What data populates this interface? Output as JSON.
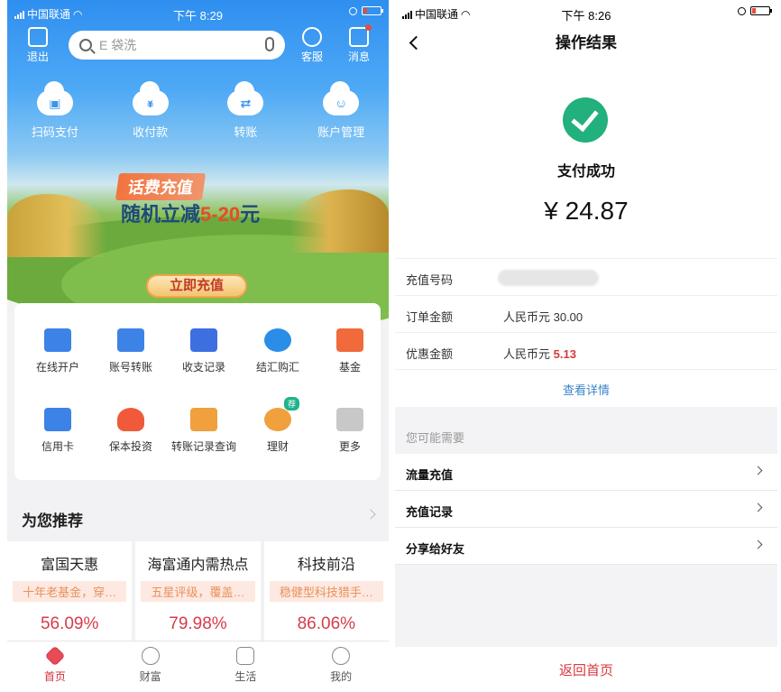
{
  "left": {
    "status_bar": {
      "carrier": "中国联通",
      "time": "下午 8:29"
    },
    "topbar": {
      "logout": "退出",
      "search_placeholder": "E 袋洗",
      "service": "客服",
      "messages": "消息"
    },
    "quick_actions": [
      "扫码支付",
      "收付款",
      "转账",
      "账户管理"
    ],
    "quick_icons": [
      "qr-scan-icon",
      "yen-icon",
      "transfer-icon",
      "user-icon"
    ],
    "banner": {
      "tag": "话费充值",
      "line_prefix": "随机立减",
      "line_amount": "5-20",
      "line_suffix": "元",
      "button": "立即充值"
    },
    "grid": [
      {
        "label": "在线开户",
        "icon": "card-e-icon",
        "color": "#3d82e6"
      },
      {
        "label": "账号转账",
        "icon": "card-transfer-icon",
        "color": "#3d82e6"
      },
      {
        "label": "收支记录",
        "icon": "ledger-icon",
        "color": "#3d6fe0"
      },
      {
        "label": "结汇购汇",
        "icon": "currency-exchange-icon",
        "color": "#2a8ee8"
      },
      {
        "label": "基金",
        "icon": "fund-chart-icon",
        "color": "#f06a3c"
      },
      {
        "label": "信用卡",
        "icon": "credit-card-icon",
        "color": "#3d82e6"
      },
      {
        "label": "保本投资",
        "icon": "shield-icon",
        "color": "#f05a3a"
      },
      {
        "label": "转账记录查询",
        "icon": "record-search-icon",
        "color": "#f0a03c"
      },
      {
        "label": "理财",
        "icon": "money-bag-icon",
        "color": "#f0a03c",
        "badge": "荐"
      },
      {
        "label": "更多",
        "icon": "more-grid-icon",
        "color": "#c8c8c8"
      }
    ],
    "recommend_title": "为您推荐",
    "products": [
      {
        "title": "富国天惠",
        "sub": "十年老基金，穿…",
        "value": "56.09%"
      },
      {
        "title": "海富通内需热点",
        "sub": "五星评级，覆盖…",
        "value": "79.98%"
      },
      {
        "title": "科技前沿",
        "sub": "稳健型科技猎手…",
        "value": "86.06%"
      }
    ],
    "tabs": [
      {
        "label": "首页",
        "icon": "diamond-icon"
      },
      {
        "label": "财富",
        "icon": "wealth-icon"
      },
      {
        "label": "生活",
        "icon": "life-bag-icon"
      },
      {
        "label": "我的",
        "icon": "profile-icon"
      }
    ]
  },
  "right": {
    "status_bar": {
      "carrier": "中国联通",
      "time": "下午 8:26"
    },
    "title": "操作结果",
    "status_text": "支付成功",
    "amount": "¥ 24.87",
    "rows": [
      {
        "key": "充值号码",
        "value": ""
      },
      {
        "key": "订单金额",
        "value": "人民币元 30.00"
      },
      {
        "key": "优惠金额",
        "prefix": "人民币元 ",
        "value": "5.13"
      }
    ],
    "detail_link": "查看详情",
    "may_need": "您可能需要",
    "links": [
      "流量充值",
      "充值记录",
      "分享给好友"
    ],
    "home_link": "返回首页"
  }
}
